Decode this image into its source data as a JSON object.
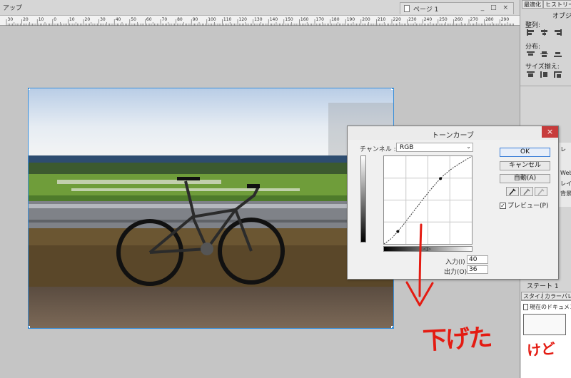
{
  "app": {
    "label": "アップ"
  },
  "document_tab": {
    "title": "ページ 1"
  },
  "ruler": {
    "ticks": [
      "30",
      "20",
      "10",
      "0",
      "10",
      "20",
      "30",
      "40",
      "50",
      "60",
      "70",
      "80",
      "90",
      "100",
      "110",
      "120",
      "130",
      "140",
      "150",
      "160",
      "170",
      "180",
      "190",
      "200",
      "210",
      "220",
      "230",
      "240",
      "250",
      "260",
      "270",
      "280",
      "290"
    ]
  },
  "right_panel": {
    "tabs": [
      "最適化",
      "ヒストリー"
    ],
    "section_title": "オブジェ",
    "align_label": "整列:",
    "distribute_label": "分布:",
    "size_label": "サイズ揃え:",
    "side_items": [
      "Web",
      "レイヤ",
      "背景"
    ],
    "state_label": "ステート 1",
    "style_tabs": [
      "スタイル",
      "カラーパレッ"
    ],
    "style_item": "現在のドキュメン"
  },
  "dialog": {
    "title": "トーンカーブ",
    "close": "×",
    "channel_label": "チャンネル :",
    "channel_value": "RGB",
    "input_label": "入力(I) :",
    "input_value": "40",
    "output_label": "出力(O) :",
    "output_value": "36",
    "ok_label": "OK",
    "cancel_label": "キャンセル",
    "auto_label": "自動(A)",
    "preview_label": "プレビュー(P)",
    "preview_checked": true,
    "curve_points": [
      [
        0,
        0
      ],
      [
        40,
        36
      ],
      [
        164,
        190
      ],
      [
        255,
        255
      ]
    ]
  },
  "annotation": {
    "text": "下げた",
    "small": "けど",
    "color": "#e41b12"
  }
}
